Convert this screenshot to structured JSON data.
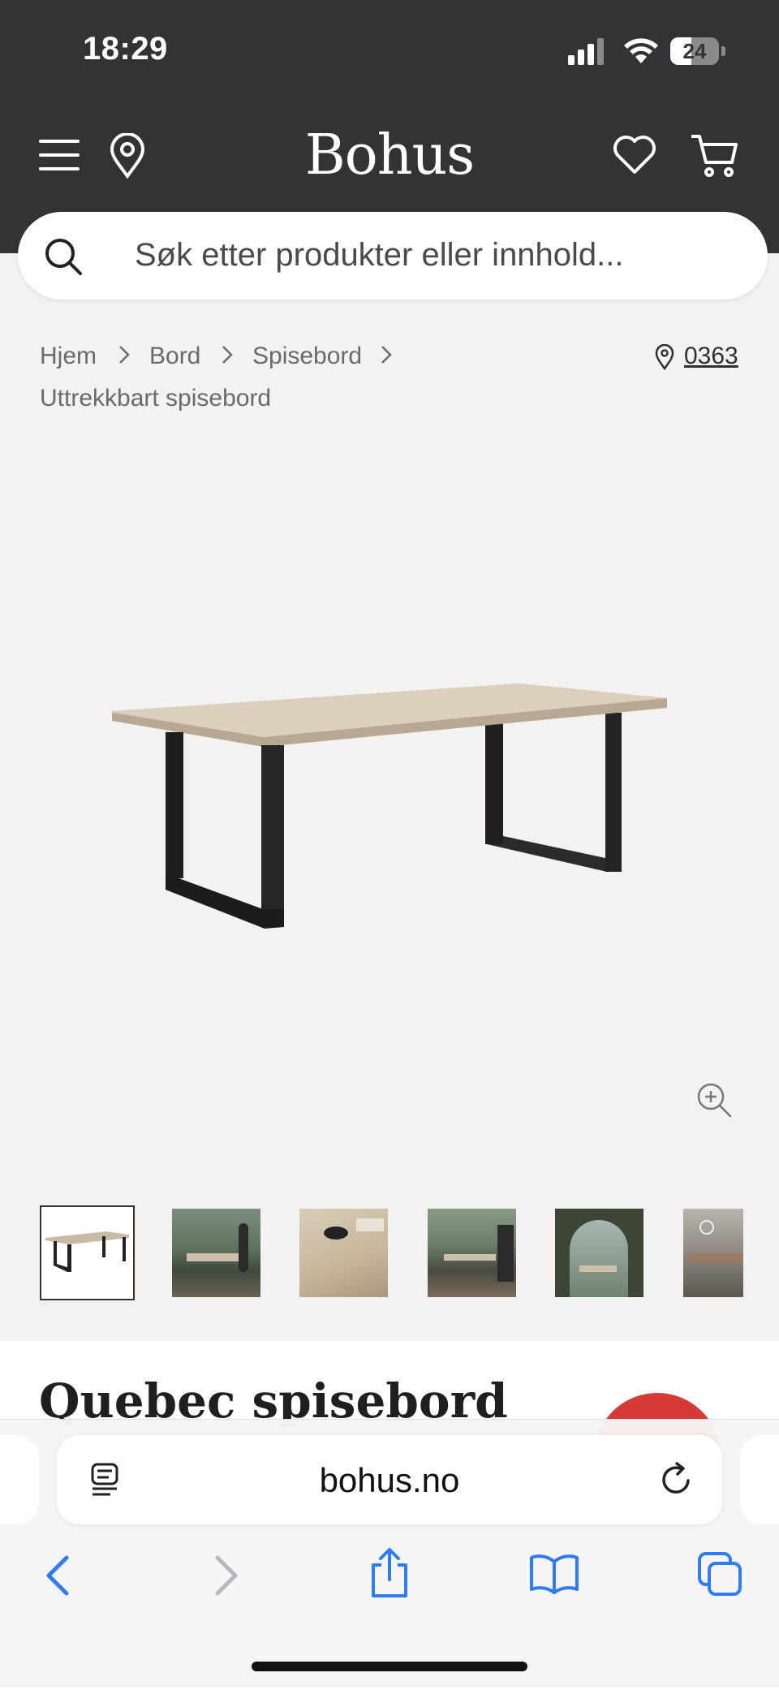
{
  "status_bar": {
    "time": "18:29",
    "battery": "24"
  },
  "header": {
    "logo": "Bohus"
  },
  "search": {
    "placeholder": "Søk etter produkter eller innhold..."
  },
  "breadcrumb": {
    "items": [
      "Hjem",
      "Bord",
      "Spisebord",
      "Uttrekkbart spisebord"
    ],
    "store": "0363"
  },
  "product": {
    "title": "Quebec spisebord"
  },
  "browser": {
    "url": "bohus.no"
  },
  "colors": {
    "header_bg": "#333336",
    "page_bg": "#f4f2f0",
    "badge": "#d73a36",
    "safari_blue": "#2f7cf6"
  },
  "icons": [
    "menu-icon",
    "location-pin-icon",
    "heart-icon",
    "cart-icon",
    "search-icon",
    "zoom-in-icon",
    "reader-icon",
    "reload-icon",
    "back-icon",
    "forward-icon",
    "share-icon",
    "bookmarks-icon",
    "tabs-icon"
  ]
}
